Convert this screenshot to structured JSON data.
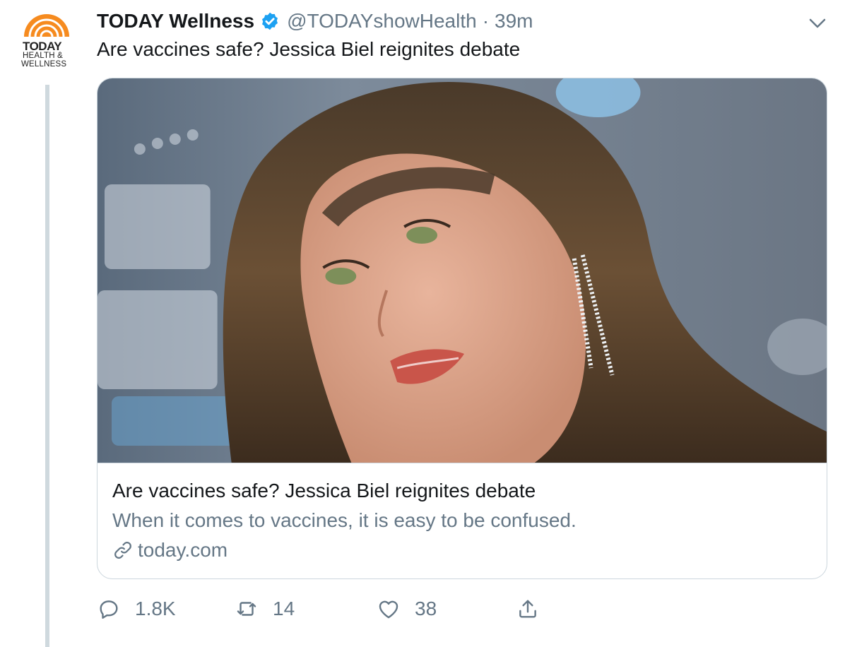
{
  "avatar": {
    "line1": "TODAY",
    "line2": "HEALTH &",
    "line3": "WELLNESS"
  },
  "tweet": {
    "display_name": "TODAY Wellness",
    "handle": "@TODAYshowHealth",
    "separator": "·",
    "time": "39m",
    "text": "Are vaccines safe? Jessica Biel reignites debate"
  },
  "card": {
    "title": "Are vaccines safe? Jessica Biel reignites debate",
    "description": "When it comes to vaccines, it is easy to be confused.",
    "domain": "today.com"
  },
  "actions": {
    "replies": "1.8K",
    "retweets": "14",
    "likes": "38"
  },
  "icons": {
    "verified": "verified-badge-icon",
    "caret": "chevron-down-icon",
    "link": "link-icon",
    "reply": "reply-icon",
    "retweet": "retweet-icon",
    "like": "heart-icon",
    "share": "share-icon"
  },
  "colors": {
    "accent": "#1da1f2",
    "secondary_text": "#657786",
    "border": "#ccd6dd",
    "brand_orange": "#f68b1f"
  }
}
